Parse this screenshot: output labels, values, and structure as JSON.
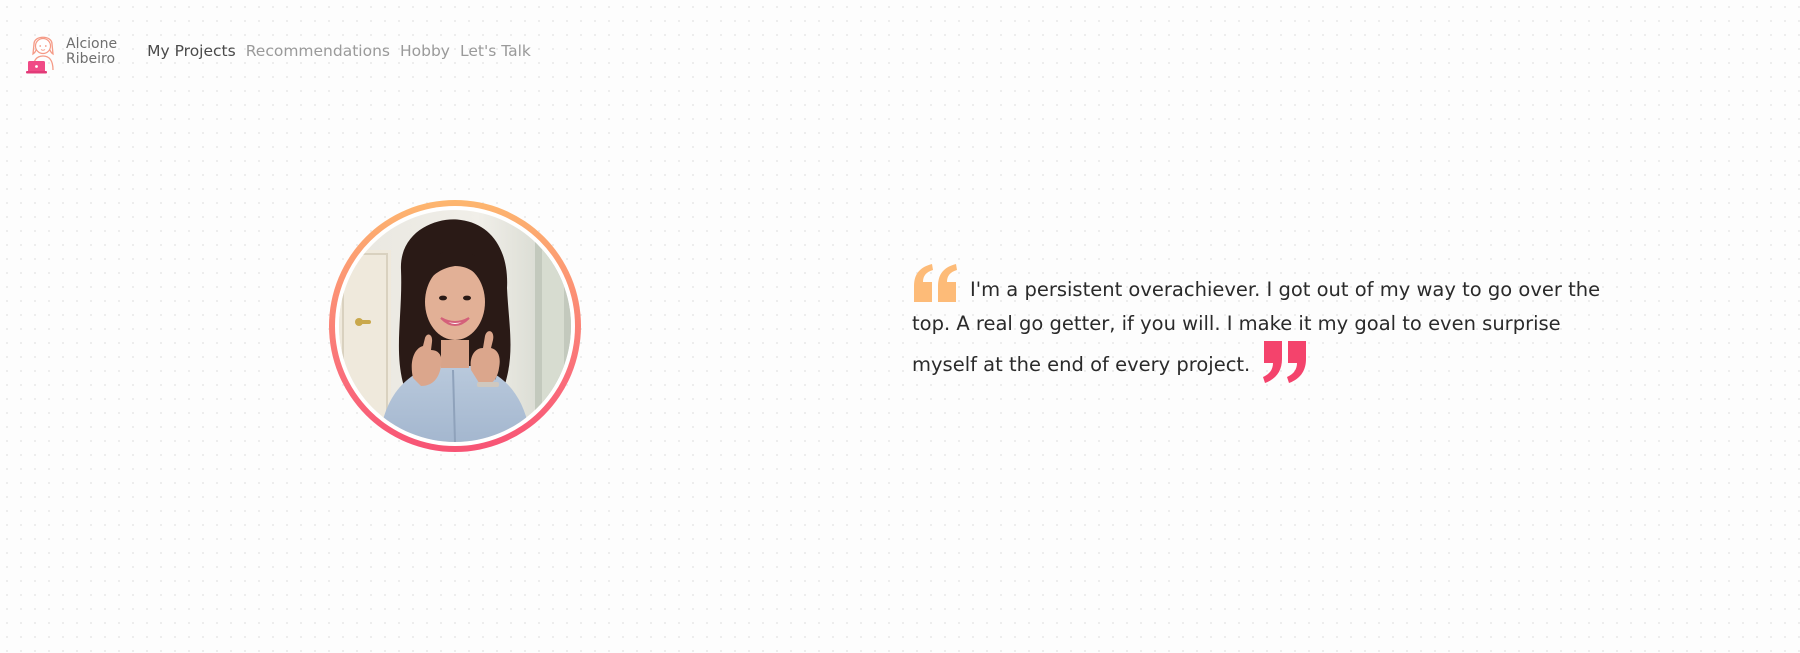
{
  "header": {
    "logo": {
      "name_line1": "Alcione",
      "name_line2": "Ribeiro",
      "icon": "girl-avatar-icon"
    },
    "nav": [
      {
        "label": "My Projects",
        "active": true
      },
      {
        "label": "Recommendations",
        "active": false
      },
      {
        "label": "Hobby",
        "active": false
      },
      {
        "label": "Let's Talk",
        "active": false
      }
    ]
  },
  "hero": {
    "portrait": {
      "icon": "profile-photo",
      "ring_colors": [
        "#fdb66e",
        "#f75375"
      ]
    },
    "quote": {
      "text": "I'm a persistent overachiever. I got out of my way to go over the top. A real go getter, if you will. I make it my goal to even surprise myself at the end of every project.",
      "open_icon": "open-quote-icon",
      "close_icon": "close-quote-icon",
      "open_color": "#fdbb78",
      "close_color": "#f4436c"
    }
  }
}
